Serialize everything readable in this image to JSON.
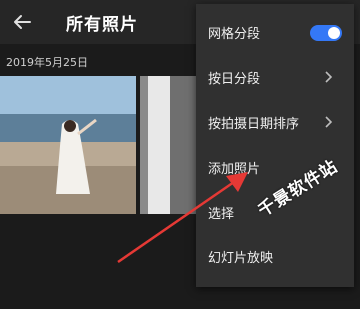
{
  "header": {
    "title": "所有照片",
    "back_icon": "arrow-left-icon"
  },
  "date_group": {
    "label": "2019年5月25日"
  },
  "menu": {
    "items": [
      {
        "label": "网格分段",
        "control": "toggle",
        "state": "on"
      },
      {
        "label": "按日分段",
        "control": "chevron"
      },
      {
        "label": "按拍摄日期排序",
        "control": "chevron"
      },
      {
        "label": "添加照片",
        "control": "chevron"
      },
      {
        "label": "选择",
        "control": "none"
      },
      {
        "label": "幻灯片放映",
        "control": "none"
      }
    ]
  },
  "watermark": {
    "text": "千景软件站"
  },
  "colors": {
    "accent": "#3478f6",
    "arrow": "#e53935",
    "menu_bg": "#303030",
    "app_bg": "#1b1b1b"
  }
}
